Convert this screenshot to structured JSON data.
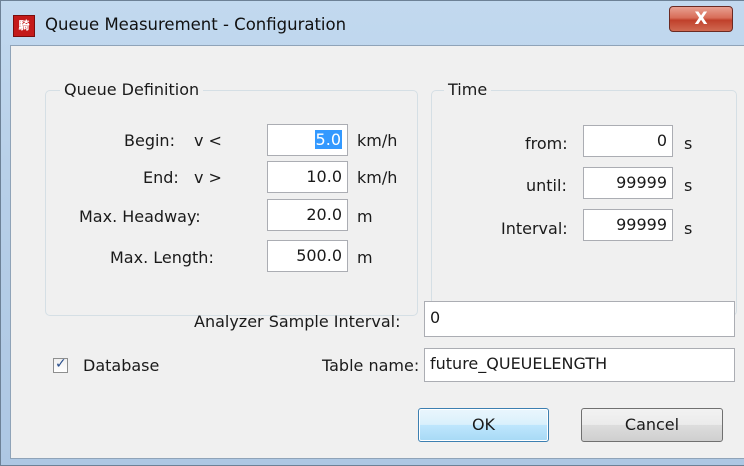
{
  "window": {
    "title": "Queue Measurement - Configuration",
    "app_icon_text": "騎",
    "close_glyph": "X"
  },
  "queue_definition": {
    "legend": "Queue Definition",
    "begin": {
      "label": "Begin:",
      "op": "v <",
      "value": "5.0",
      "unit": "km/h"
    },
    "end": {
      "label": "End:",
      "op": "v >",
      "value": "10.0",
      "unit": "km/h"
    },
    "max_headway": {
      "label": "Max. Headway:",
      "value": "20.0",
      "unit": "m"
    },
    "max_length": {
      "label": "Max. Length:",
      "value": "500.0",
      "unit": "m"
    }
  },
  "time": {
    "legend": "Time",
    "from": {
      "label": "from:",
      "value": "0",
      "unit": "s"
    },
    "until": {
      "label": "until:",
      "value": "99999",
      "unit": "s"
    },
    "interval": {
      "label": "Interval:",
      "value": "99999",
      "unit": "s"
    }
  },
  "analyzer": {
    "label": "Analyzer Sample Interval:",
    "value": "0"
  },
  "database": {
    "label": "Database",
    "checked": true
  },
  "table_name": {
    "label": "Table name:",
    "value": "future_QUEUELENGTH"
  },
  "buttons": {
    "ok": "OK",
    "cancel": "Cancel"
  }
}
